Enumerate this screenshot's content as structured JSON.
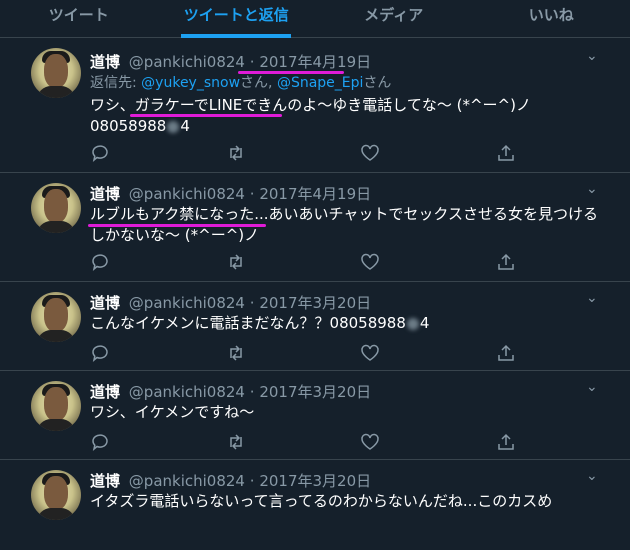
{
  "tabs": [
    "ツイート",
    "ツイートと返信",
    "メディア",
    "いいね"
  ],
  "colors": {
    "accent": "#1da1f2",
    "highlight": "#e01bd8",
    "background": "#15202b"
  },
  "tweets": [
    {
      "name": "道博",
      "handle": "@pankichi0824",
      "dot": "·",
      "date": "2017年4月19日",
      "replying_prefix": "返信先: ",
      "reply_1": "@yukey_snow",
      "reply_sep": "さん, ",
      "reply_2": "@Snape_Epi",
      "reply_suffix": "さん",
      "line1": "ワシ、ガラケーでLINEできんのよ～ゆき電話してな～ (*^ー^)ノ",
      "line2a": "08058988",
      "line2b": "4"
    },
    {
      "name": "道博",
      "handle": "@pankichi0824",
      "dot": "·",
      "date": "2017年4月19日",
      "text": "ルブルもアク禁になった...あいあいチャットでセックスさせる女を見つけるしかないな～ (*^ー^)ノ"
    },
    {
      "name": "道博",
      "handle": "@pankichi0824",
      "dot": "·",
      "date": "2017年3月20日",
      "text_a": "こんなイケメンに電話まだなん？？08058988",
      "text_b": "4"
    },
    {
      "name": "道博",
      "handle": "@pankichi0824",
      "dot": "·",
      "date": "2017年3月20日",
      "text": "ワシ、イケメンですね～"
    },
    {
      "name": "道博",
      "handle": "@pankichi0824",
      "dot": "·",
      "date": "2017年3月20日",
      "text": "イタズラ電話いらないって言ってるのわからないんだね...このカスめ"
    }
  ],
  "icons": {
    "reply": "reply-icon",
    "retweet": "retweet-icon",
    "like": "like-icon",
    "share": "share-icon",
    "caret": "chevron-down-icon"
  },
  "caret_glyph": "⌄"
}
